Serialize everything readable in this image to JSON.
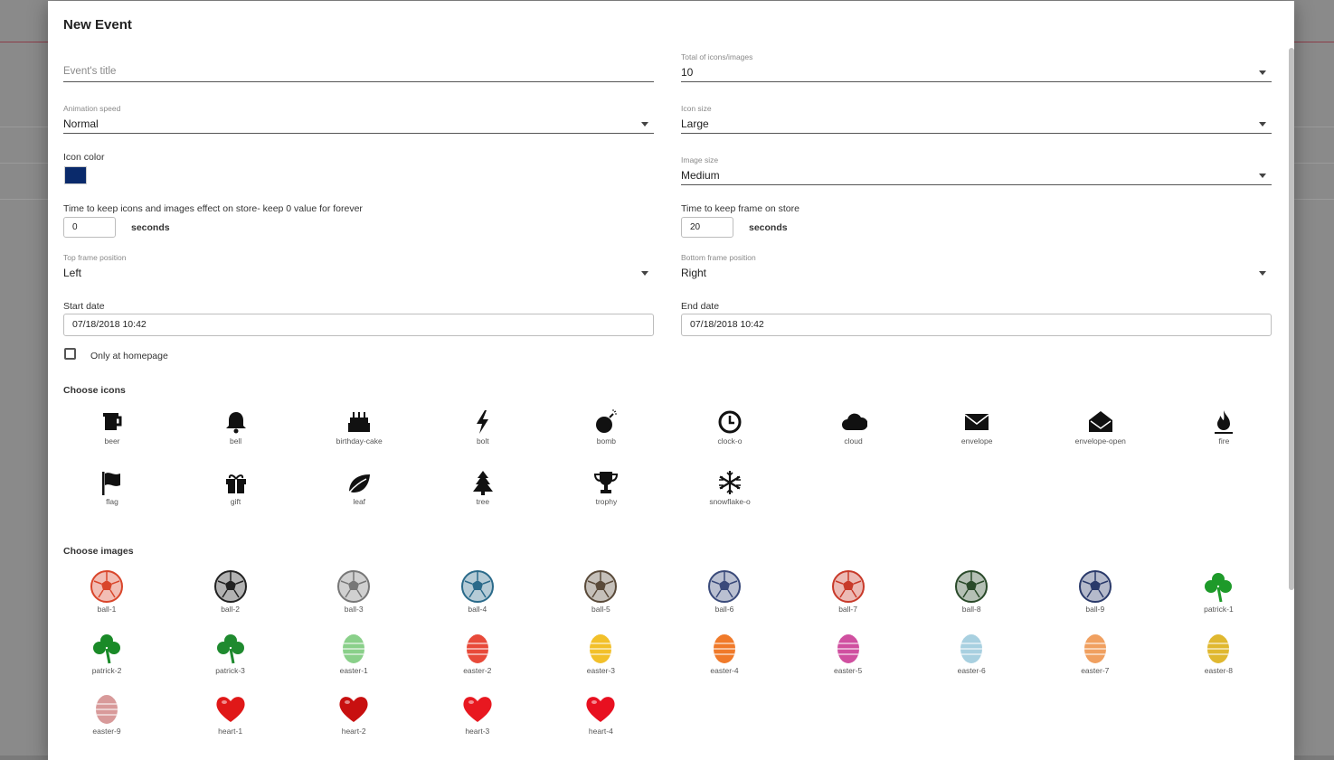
{
  "modal": {
    "title": "New Event",
    "fields": {
      "event_title_placeholder": "Event's title",
      "total_label": "Total of icons/images",
      "total_value": "10",
      "anim_label": "Animation speed",
      "anim_value": "Normal",
      "icon_size_label": "Icon size",
      "icon_size_value": "Large",
      "icon_color_label": "Icon color",
      "icon_color_value": "#0a2a6b",
      "image_size_label": "Image size",
      "image_size_value": "Medium",
      "time_keep_icons_label": "Time to keep icons and images effect on store- keep 0 value for forever",
      "time_keep_icons_value": "0",
      "time_keep_frame_label": "Time to keep frame on store",
      "time_keep_frame_value": "20",
      "seconds": "seconds",
      "top_frame_label": "Top frame position",
      "top_frame_value": "Left",
      "bottom_frame_label": "Bottom frame position",
      "bottom_frame_value": "Right",
      "start_date_label": "Start date",
      "start_date_value": "07/18/2018 10:42",
      "end_date_label": "End date",
      "end_date_value": "07/18/2018 10:42",
      "only_homepage_label": "Only at homepage"
    },
    "icons_title": "Choose icons",
    "icons": [
      {
        "name": "beer"
      },
      {
        "name": "bell"
      },
      {
        "name": "birthday-cake"
      },
      {
        "name": "bolt"
      },
      {
        "name": "bomb"
      },
      {
        "name": "clock-o"
      },
      {
        "name": "cloud"
      },
      {
        "name": "envelope"
      },
      {
        "name": "envelope-open"
      },
      {
        "name": "fire"
      },
      {
        "name": "flag"
      },
      {
        "name": "gift"
      },
      {
        "name": "leaf"
      },
      {
        "name": "tree"
      },
      {
        "name": "trophy"
      },
      {
        "name": "snowflake-o"
      }
    ],
    "images_title": "Choose images",
    "images": [
      {
        "name": "ball-1",
        "color": "#d9462b"
      },
      {
        "name": "ball-2",
        "color": "#222222"
      },
      {
        "name": "ball-3",
        "color": "#777777"
      },
      {
        "name": "ball-4",
        "color": "#2a6a8a"
      },
      {
        "name": "ball-5",
        "color": "#5a4a3a"
      },
      {
        "name": "ball-6",
        "color": "#3a4a7a"
      },
      {
        "name": "ball-7",
        "color": "#c83a2a"
      },
      {
        "name": "ball-8",
        "color": "#2a4a2a"
      },
      {
        "name": "ball-9",
        "color": "#2a3a6a"
      },
      {
        "name": "patrick-1",
        "color": "#1e9a2a"
      },
      {
        "name": "patrick-2",
        "color": "#1a8a28"
      },
      {
        "name": "patrick-3",
        "color": "#1f8a2f"
      },
      {
        "name": "easter-1",
        "color": "#8ad08a"
      },
      {
        "name": "easter-2",
        "color": "#e84a3a"
      },
      {
        "name": "easter-3",
        "color": "#f2c02a"
      },
      {
        "name": "easter-4",
        "color": "#f07a2a"
      },
      {
        "name": "easter-5",
        "color": "#d050a0"
      },
      {
        "name": "easter-6",
        "color": "#a8d0e0"
      },
      {
        "name": "easter-7",
        "color": "#f0a060"
      },
      {
        "name": "easter-8",
        "color": "#e0b830"
      },
      {
        "name": "easter-9",
        "color": "#d89a9a"
      },
      {
        "name": "heart-1",
        "color": "#e01818"
      },
      {
        "name": "heart-2",
        "color": "#c81010"
      },
      {
        "name": "heart-3",
        "color": "#e81820"
      },
      {
        "name": "heart-4",
        "color": "#e81020"
      }
    ]
  }
}
